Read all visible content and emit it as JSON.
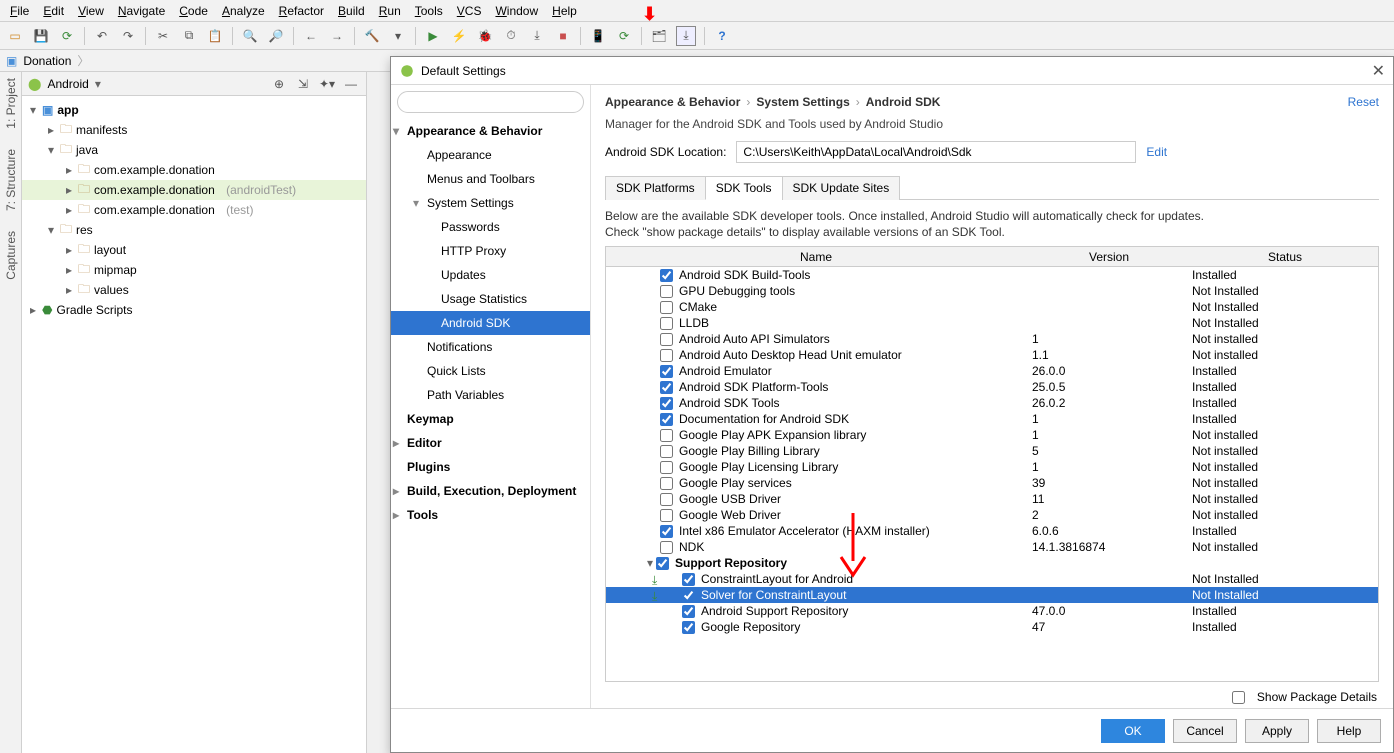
{
  "menu": [
    "File",
    "Edit",
    "View",
    "Navigate",
    "Code",
    "Analyze",
    "Refactor",
    "Build",
    "Run",
    "Tools",
    "VCS",
    "Window",
    "Help"
  ],
  "crumb": {
    "project": "Donation"
  },
  "projectPanel": {
    "selector": "Android",
    "tree": {
      "app": "app",
      "manifests": "manifests",
      "java": "java",
      "pkg1": "com.example.donation",
      "pkg2": "com.example.donation",
      "pkg2_suffix": "(androidTest)",
      "pkg3": "com.example.donation",
      "pkg3_suffix": "(test)",
      "res": "res",
      "layout": "layout",
      "mipmap": "mipmap",
      "values": "values",
      "gradle": "Gradle Scripts"
    }
  },
  "dialog": {
    "title": "Default Settings",
    "reset": "Reset",
    "breadcrumb": {
      "a": "Appearance & Behavior",
      "b": "System Settings",
      "c": "Android SDK"
    },
    "subtitle": "Manager for the Android SDK and Tools used by Android Studio",
    "sdkLocLabel": "Android SDK Location:",
    "sdkLocPath": "C:\\Users\\Keith\\AppData\\Local\\Android\\Sdk",
    "edit": "Edit",
    "categories": {
      "appearanceBehavior": "Appearance & Behavior",
      "appearance": "Appearance",
      "menusToolbars": "Menus and Toolbars",
      "systemSettings": "System Settings",
      "passwords": "Passwords",
      "httpProxy": "HTTP Proxy",
      "updates": "Updates",
      "usageStats": "Usage Statistics",
      "androidSdk": "Android SDK",
      "notifications": "Notifications",
      "quickLists": "Quick Lists",
      "pathVars": "Path Variables",
      "keymap": "Keymap",
      "editor": "Editor",
      "plugins": "Plugins",
      "buildExec": "Build, Execution, Deployment",
      "tools": "Tools"
    },
    "tabs": {
      "platforms": "SDK Platforms",
      "tools": "SDK Tools",
      "update": "SDK Update Sites"
    },
    "tabHelp1": "Below are the available SDK developer tools. Once installed, Android Studio will automatically check for updates.",
    "tabHelp2": "Check \"show package details\" to display available versions of an SDK Tool.",
    "headers": {
      "name": "Name",
      "version": "Version",
      "status": "Status"
    },
    "items": [
      {
        "name": "Android SDK Build-Tools",
        "ver": "",
        "status": "Installed",
        "checked": true,
        "indent": 0
      },
      {
        "name": "GPU Debugging tools",
        "ver": "",
        "status": "Not Installed",
        "checked": false,
        "indent": 0
      },
      {
        "name": "CMake",
        "ver": "",
        "status": "Not Installed",
        "checked": false,
        "indent": 0
      },
      {
        "name": "LLDB",
        "ver": "",
        "status": "Not Installed",
        "checked": false,
        "indent": 0
      },
      {
        "name": "Android Auto API Simulators",
        "ver": "1",
        "status": "Not installed",
        "checked": false,
        "indent": 0
      },
      {
        "name": "Android Auto Desktop Head Unit emulator",
        "ver": "1.1",
        "status": "Not installed",
        "checked": false,
        "indent": 0
      },
      {
        "name": "Android Emulator",
        "ver": "26.0.0",
        "status": "Installed",
        "checked": true,
        "indent": 0
      },
      {
        "name": "Android SDK Platform-Tools",
        "ver": "25.0.5",
        "status": "Installed",
        "checked": true,
        "indent": 0
      },
      {
        "name": "Android SDK Tools",
        "ver": "26.0.2",
        "status": "Installed",
        "checked": true,
        "indent": 0
      },
      {
        "name": "Documentation for Android SDK",
        "ver": "1",
        "status": "Installed",
        "checked": true,
        "indent": 0
      },
      {
        "name": "Google Play APK Expansion library",
        "ver": "1",
        "status": "Not installed",
        "checked": false,
        "indent": 0
      },
      {
        "name": "Google Play Billing Library",
        "ver": "5",
        "status": "Not installed",
        "checked": false,
        "indent": 0
      },
      {
        "name": "Google Play Licensing Library",
        "ver": "1",
        "status": "Not installed",
        "checked": false,
        "indent": 0
      },
      {
        "name": "Google Play services",
        "ver": "39",
        "status": "Not installed",
        "checked": false,
        "indent": 0
      },
      {
        "name": "Google USB Driver",
        "ver": "11",
        "status": "Not installed",
        "checked": false,
        "indent": 0
      },
      {
        "name": "Google Web Driver",
        "ver": "2",
        "status": "Not installed",
        "checked": false,
        "indent": 0
      },
      {
        "name": "Intel x86 Emulator Accelerator (HAXM installer)",
        "ver": "6.0.6",
        "status": "Installed",
        "checked": true,
        "indent": 0
      },
      {
        "name": "NDK",
        "ver": "14.1.3816874",
        "status": "Not installed",
        "checked": false,
        "indent": 0
      },
      {
        "name": "Support Repository",
        "ver": "",
        "status": "",
        "checked": true,
        "indent": 0,
        "bold": true,
        "expander": true
      },
      {
        "name": "ConstraintLayout for Android",
        "ver": "",
        "status": "Not Installed",
        "checked": true,
        "indent": 1,
        "dl": true
      },
      {
        "name": "Solver for ConstraintLayout",
        "ver": "",
        "status": "Not Installed",
        "checked": true,
        "indent": 1,
        "dl": true,
        "selected": true
      },
      {
        "name": "Android Support Repository",
        "ver": "47.0.0",
        "status": "Installed",
        "checked": true,
        "indent": 1
      },
      {
        "name": "Google Repository",
        "ver": "47",
        "status": "Installed",
        "checked": true,
        "indent": 1
      }
    ],
    "showPkg": "Show Package Details",
    "buttons": {
      "ok": "OK",
      "cancel": "Cancel",
      "apply": "Apply",
      "help": "Help"
    }
  },
  "leftrail": {
    "project": "1: Project",
    "structure": "7: Structure",
    "captures": "Captures"
  }
}
